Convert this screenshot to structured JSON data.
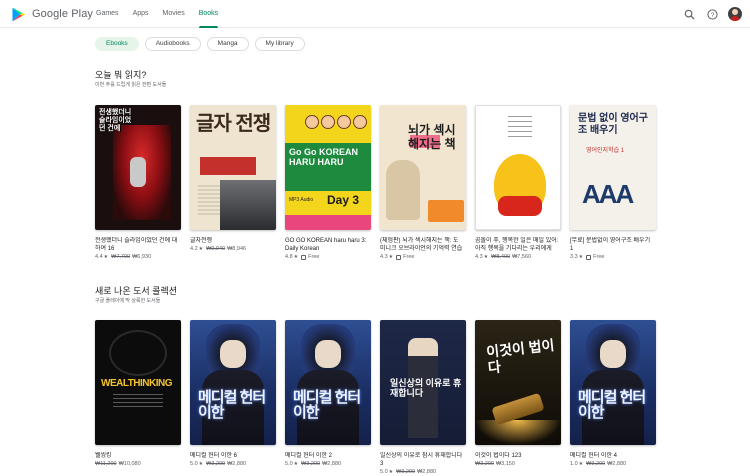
{
  "header": {
    "logo_text": "Google Play",
    "nav": [
      "Games",
      "Apps",
      "Movies",
      "Books"
    ],
    "active_nav": "Books"
  },
  "chips": [
    "Ebooks",
    "Audiobooks",
    "Manga",
    "My library"
  ],
  "sections": [
    {
      "title": "오늘 뭐 읽지?",
      "subtitle": "이번 주를 드립게 읽은 한편 도서들",
      "books": [
        {
          "title": "전생했더니 슬라임이었던 건에 대하여 16",
          "rating": "4.4",
          "old_price": "₩7,700",
          "price": "₩6,930",
          "cover_text": "전생했더니 슬라임이었던 건에"
        },
        {
          "title": "글자전쟁",
          "rating": "4.2",
          "old_price": "₩9,940",
          "price": "₩8,946",
          "cover_text": "글자 전쟁"
        },
        {
          "title": "GO GO KOREAN haru haru 3: Daily Korean",
          "rating": "4.8",
          "old_price": "",
          "price": "Free",
          "cover_text": "Go Go KOREAN HARU HARU",
          "cover_day": "Day 3",
          "cover_mp3": "MP3 Audio"
        },
        {
          "title": "(체험판) 뇌가 섹시해지는 책: 도미니크 오브라이언의 기억력 연습 ...",
          "rating": "4.3",
          "old_price": "",
          "price": "Free",
          "cover_text": "뇌가 섹시해지는 책"
        },
        {
          "title": "곰돌이 푸, 행복한 일은 매일 있어: 아직 행복을 기다리는 우리에게",
          "rating": "4.3",
          "old_price": "₩8,400",
          "price": "₩7,560",
          "cover_text": ""
        },
        {
          "title": "[무료] 문법없이 영어구조 배우기 1",
          "rating": "3.3",
          "old_price": "",
          "price": "Free",
          "cover_text": "문법 없이 영어구조 배우기",
          "cover_sub": "영어인지학습 1"
        }
      ]
    },
    {
      "title": "새로 나온 도서 콜렉션",
      "subtitle": "구글 플레이에 막 상륙한 도서들",
      "books": [
        {
          "title": "웰씽킹",
          "rating": "",
          "old_price": "₩11,200",
          "price": "₩10,080",
          "cover_text": "WEALTHINKING"
        },
        {
          "title": "메디컬 헌터 이한 6",
          "rating": "5.0",
          "old_price": "₩3,200",
          "price": "₩2,880",
          "cover_text": "메디컬 헌터 이한"
        },
        {
          "title": "메디컬 헌터 이한 2",
          "rating": "5.0",
          "old_price": "₩3,200",
          "price": "₩2,880",
          "cover_text": "메디컬 헌터 이한"
        },
        {
          "title": "일신상의 이유로 잠시 휴재합니다 3",
          "rating": "5.0",
          "old_price": "₩3,200",
          "price": "₩2,880",
          "cover_text": "일신상의 이유로 휴재합니다"
        },
        {
          "title": "이것이 법이다 123",
          "rating": "",
          "old_price": "₩3,200",
          "price": "₩3,150",
          "cover_text": "이것이 법이다"
        },
        {
          "title": "메디컬 헌터 이한 4",
          "rating": "1.0",
          "old_price": "₩3,200",
          "price": "₩2,880",
          "cover_text": "메디컬 헌터 이한"
        }
      ]
    }
  ]
}
